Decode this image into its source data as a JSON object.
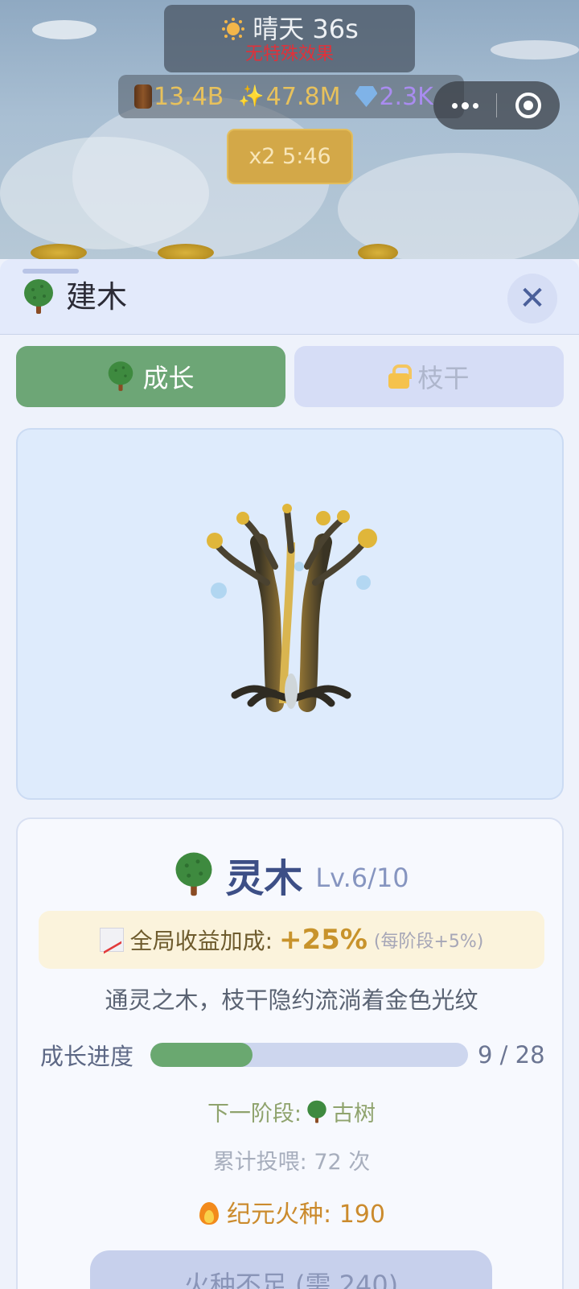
{
  "weather": {
    "icon": "sun-icon",
    "label": "晴天 36s",
    "effect": "无特殊效果"
  },
  "resources": {
    "wood": "13.4B",
    "spark": "47.8M",
    "gem": "2.3K"
  },
  "boost": {
    "label": "x2 5:46"
  },
  "sheet": {
    "title": "建木",
    "tabs": [
      {
        "label": "成长",
        "active": true,
        "locked": false
      },
      {
        "label": "枝干",
        "active": false,
        "locked": true
      }
    ]
  },
  "tree": {
    "name": "灵木",
    "level": "Lv.6/10",
    "bonus_label": "全局收益加成:",
    "bonus_value": "+25%",
    "bonus_note": "(每阶段+5%)",
    "description": "通灵之木，枝干隐约流淌着金色光纹",
    "progress_label": "成长进度",
    "progress_current": 9,
    "progress_total": 28,
    "progress_text": "9 / 28",
    "next_stage_label": "下一阶段:",
    "next_stage_name": "古树",
    "total_feeds": "累计投喂: 72 次",
    "ember_text": "纪元火种: 190",
    "feed_button": "火种不足 (需 240)"
  },
  "colors": {
    "accent_green": "#6da676",
    "gold": "#c8932b",
    "title_blue": "#3d4f86"
  }
}
